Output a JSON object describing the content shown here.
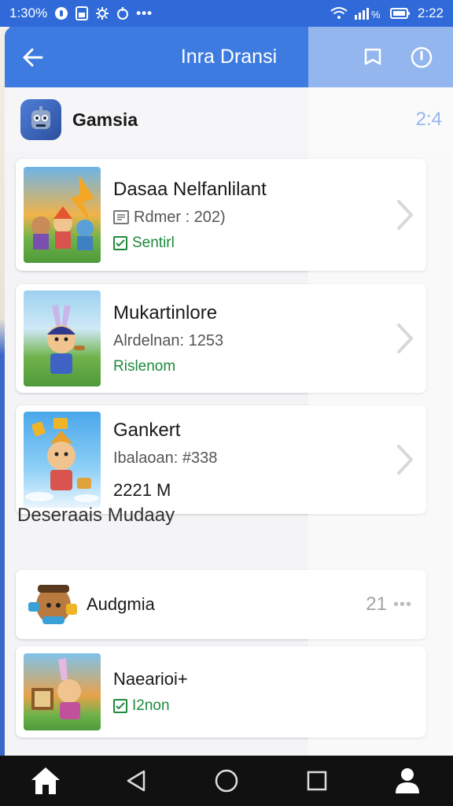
{
  "status_bar": {
    "left_text": "1:30%",
    "right_time": "2:22",
    "battery": "",
    "left_icons": [
      "circle-badge-icon",
      "sim-icon",
      "settings-icon",
      "drop-icon"
    ],
    "right_icons": [
      "wifi-icon",
      "signal-icon",
      "battery-icon"
    ]
  },
  "app_bar": {
    "title": "Inra Dransi"
  },
  "section": {
    "title": "Gamsia",
    "count": "2:4"
  },
  "cards": [
    {
      "title": "Dasaa Nelfanlilant",
      "subtitle": "Rdmer : 202)",
      "status": "Sentirl"
    },
    {
      "title": "Mukartinlore",
      "subtitle": "Alrdelnan: 1253",
      "status": "Rislenom"
    },
    {
      "title": "Gankert",
      "subtitle": "Ibalaoan: #338",
      "size": "2221 M"
    }
  ],
  "group_label": "Deseraais Mudaay",
  "small_cards": [
    {
      "title": "Audgmia",
      "count": "21"
    },
    {
      "title": "Naearioi+",
      "status": "I2non"
    }
  ],
  "colors": {
    "accent": "#3d7be0",
    "status_green": "#1d8a3b",
    "nav_bg": "#111111"
  }
}
